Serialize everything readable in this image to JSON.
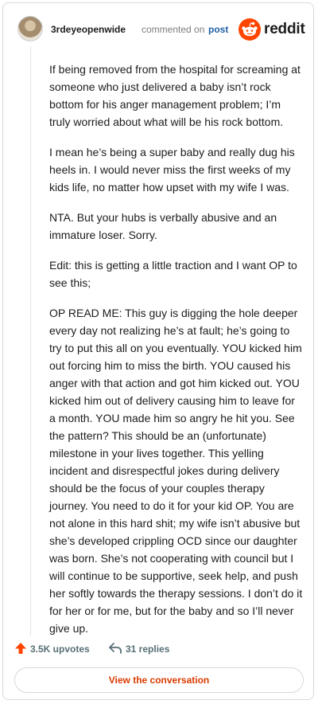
{
  "header": {
    "username": "3rdeyeopenwide",
    "commented_text": "commented on",
    "post_link": "post",
    "brand": "reddit"
  },
  "comment": {
    "paragraphs": [
      "If being removed from the hospital for screaming at someone who just delivered a baby isn’t rock bottom for his anger management problem; I’m truly worried about what will be his rock bottom.",
      "I mean he’s being a super baby and really dug his heels in. I would never miss the first weeks of my kids life, no matter how upset with my wife I was.",
      "NTA. But your hubs is verbally abusive and an immature loser. Sorry.",
      "Edit: this is getting a little traction and I want OP to see this;",
      "OP READ ME: This guy is digging the hole deeper every day not realizing he’s at fault; he’s going to try to put this all on you eventually. YOU kicked him out forcing him to miss the birth. YOU caused his anger with that action and got him kicked out. YOU kicked him out of delivery causing him to leave for a month. YOU made him so angry he hit you. See the pattern? This should be an (unfortunate) milestone in your lives together. This yelling incident and disrespectful jokes during delivery should be the focus of your couples therapy journey. You need to do it for your kid OP. You are not alone in this hard shit; my wife isn’t abusive but she’s developed crippling OCD since our daughter was born. She’s not cooperating with council but I will continue to be supportive, seek help, and push her softly towards the therapy sessions. I don’t do it for her or for me, but for the baby and so I’ll never give up."
    ]
  },
  "footer": {
    "upvotes": "3.5K upvotes",
    "replies": "31 replies",
    "view_button": "View the conversation"
  },
  "colors": {
    "brand_orange": "#ff4500",
    "link_blue": "#1f5fa8",
    "button_text": "#d93a00",
    "meta_gray": "#576f76"
  },
  "icons": [
    "user-avatar",
    "reddit-logo-icon",
    "upvote-arrow-icon",
    "reply-arrow-icon"
  ]
}
